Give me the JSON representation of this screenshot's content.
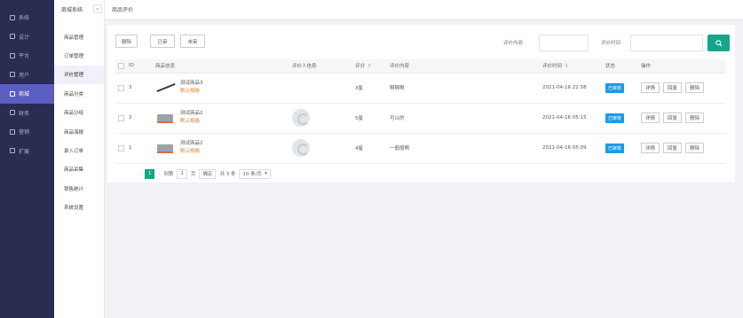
{
  "sidebar": {
    "items": [
      {
        "label": "系统",
        "icon": "gear-icon"
      },
      {
        "label": "设计",
        "icon": "monitor-icon"
      },
      {
        "label": "平台",
        "icon": "monitor-icon"
      },
      {
        "label": "用户",
        "icon": "user-icon"
      },
      {
        "label": "商城",
        "icon": "shop-icon",
        "active": true
      },
      {
        "label": "财务",
        "icon": "wallet-icon"
      },
      {
        "label": "营销",
        "icon": "tag-icon"
      },
      {
        "label": "扩展",
        "icon": "grid-icon"
      }
    ]
  },
  "submenu": {
    "title": "商城系统",
    "collapse_icon": "«",
    "items": [
      "商品管理",
      "订单管理",
      "评价管理",
      "商品分类",
      "商品分组",
      "商品海报",
      "录入订单",
      "商品采集",
      "销售统计",
      "系统设置"
    ],
    "active_index": 2
  },
  "breadcrumb": "商品评价",
  "toolbar": {
    "delete_label": "删除",
    "reviewed_label": "已审",
    "unreviewed_label": "未审",
    "content_label": "评价内容",
    "content_placeholder": "",
    "time_label": "评价时间",
    "time_placeholder": "",
    "search_icon": "search-icon"
  },
  "table": {
    "headers": {
      "id": "ID",
      "product": "商品信息",
      "reviewer": "评价人信息",
      "score": "评分",
      "content": "评价内容",
      "time": "评价时间",
      "status": "状态",
      "ops": "操作"
    },
    "rows": [
      {
        "id": "3",
        "product_name": "测试商品3",
        "product_spec": "默认规格",
        "product_img": "pen",
        "reviewer": "",
        "score": "3星",
        "content": "啊啊啊",
        "time": "2021-04-16 22:58",
        "status": "已审核",
        "ops": [
          "详情",
          "回复",
          "删除"
        ]
      },
      {
        "id": "2",
        "product_name": "测试商品2",
        "product_spec": "默认规格",
        "product_img": "box",
        "reviewer": "",
        "score": "5星",
        "content": "可以的",
        "time": "2021-04-16 05:15",
        "status": "已审核",
        "ops": [
          "详情",
          "回复",
          "删除"
        ]
      },
      {
        "id": "1",
        "product_name": "测试商品2",
        "product_spec": "默认规格",
        "product_img": "box",
        "reviewer": "",
        "score": "4星",
        "content": "一般般啊",
        "time": "2021-04-16 05:09",
        "status": "已审核",
        "ops": [
          "详情",
          "回复",
          "删除"
        ]
      }
    ]
  },
  "pager": {
    "current": "1",
    "goto_label": "到第",
    "goto_value": "1",
    "page_unit": "页",
    "confirm_label": "确定",
    "total_label": "共 3 条",
    "page_size_label": "10 条/页"
  },
  "colors": {
    "sidebar": "#2b2c51",
    "sidebar_active": "#5a5dc2",
    "accent": "#16a589",
    "status": "#1d9ae8",
    "spec": "#e47c2a"
  }
}
